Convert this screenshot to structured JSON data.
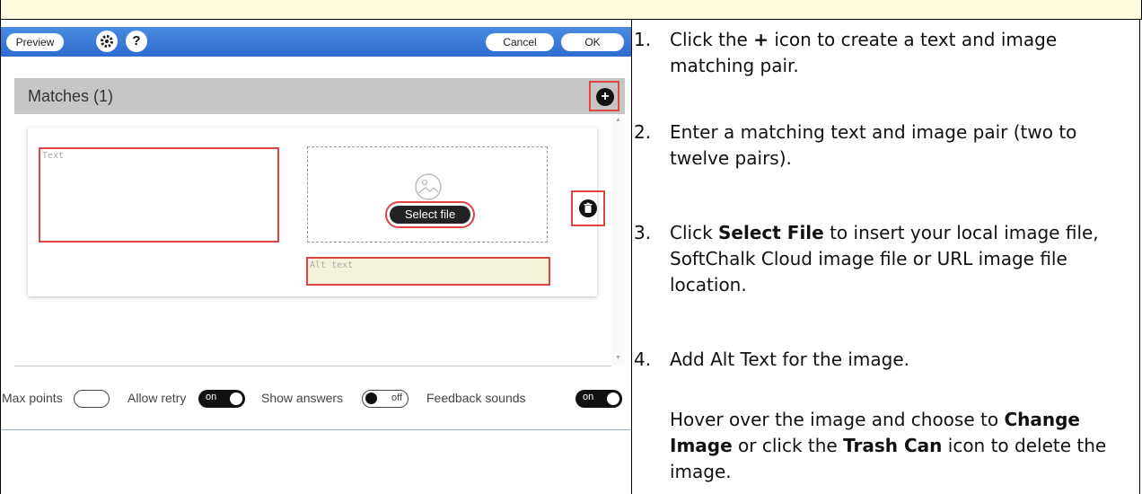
{
  "toolbar": {
    "preview_label": "Preview",
    "settings_icon": "gear-icon",
    "help_label": "?",
    "cancel_label": "Cancel",
    "ok_label": "OK",
    "accent_color": "#2e6cd0"
  },
  "matches": {
    "title": "Matches (1)",
    "add_icon": "+",
    "text_placeholder": "Text",
    "select_file_label": "Select file",
    "alt_text_placeholder": "Alt text"
  },
  "settings": {
    "max_points_label": "Max points",
    "allow_retry_label": "Allow retry",
    "allow_retry_state": "on",
    "show_answers_label": "Show answers",
    "show_answers_state": "off",
    "feedback_sounds_label": "Feedback sounds",
    "feedback_sounds_state": "on"
  },
  "instructions": {
    "step1_num": "1.",
    "step1_a": "Click the ",
    "step1_icon": "+",
    "step1_b": "  icon to create a text and image matching pair.",
    "step2_num": "2.",
    "step2": "Enter a matching text and image pair (two to twelve pairs).",
    "step3_num": "3.",
    "step3_a": "Click ",
    "step3_bold": "Select File",
    "step3_b": " to insert your local image file, SoftChalk Cloud image file or URL image file location.",
    "step4_num": "4.",
    "step4": "Add Alt Text for the image.",
    "note_a": "Hover over the image and choose to ",
    "note_bold1": "Change Image",
    "note_b": " or click the ",
    "note_bold2": "Trash Can",
    "note_c": " icon to delete the image."
  }
}
